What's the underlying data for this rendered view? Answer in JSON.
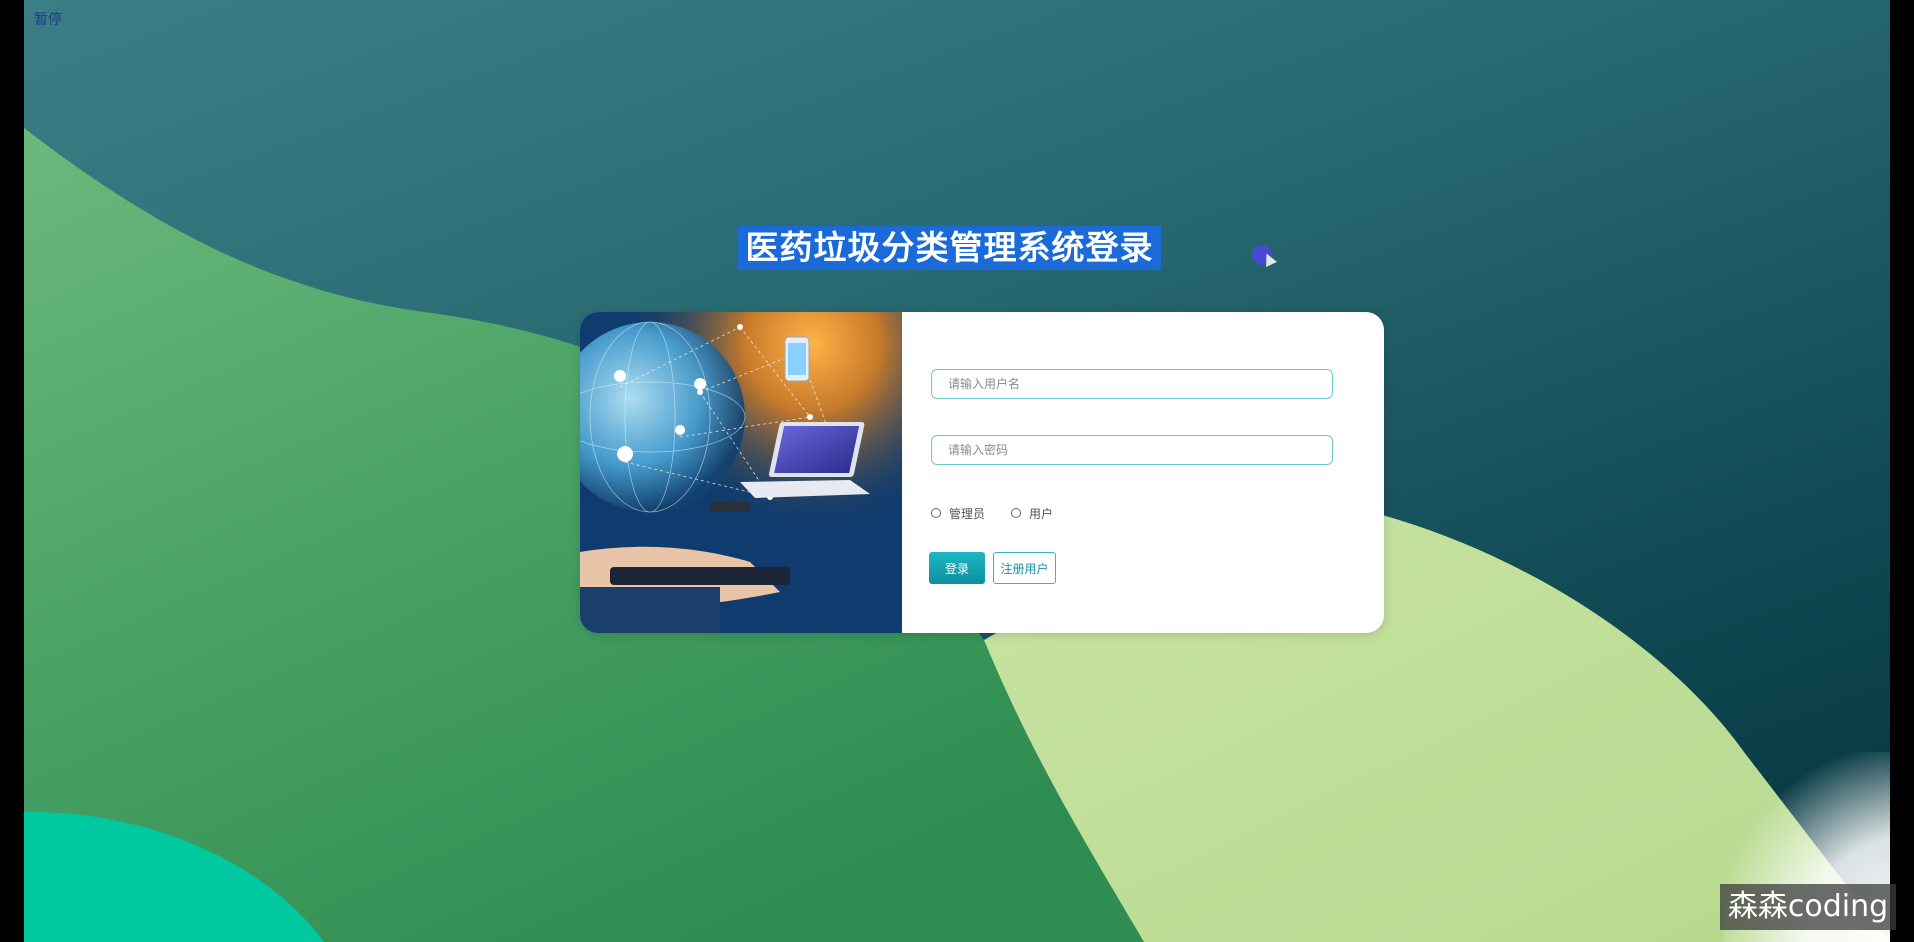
{
  "player": {
    "pause_label": "暂停"
  },
  "login": {
    "title": "医药垃圾分类管理系统登录",
    "username_placeholder": "请输入用户名",
    "password_placeholder": "请输入密码",
    "roles": [
      {
        "label": "管理员",
        "selected": false
      },
      {
        "label": "用户",
        "selected": false
      }
    ],
    "login_button": "登录",
    "register_button": "注册用户"
  },
  "watermark": "森森coding",
  "icons": {
    "cursor": "mouse-cursor-icon",
    "radio": "radio-circle-icon"
  },
  "colors": {
    "accent": "#0e9aa7",
    "title_highlight": "#1a6ad8",
    "bg_dark": "#114c57",
    "bg_green": "#45a461",
    "bg_light_green": "#bfe09a",
    "bg_teal": "#00c9a0"
  }
}
